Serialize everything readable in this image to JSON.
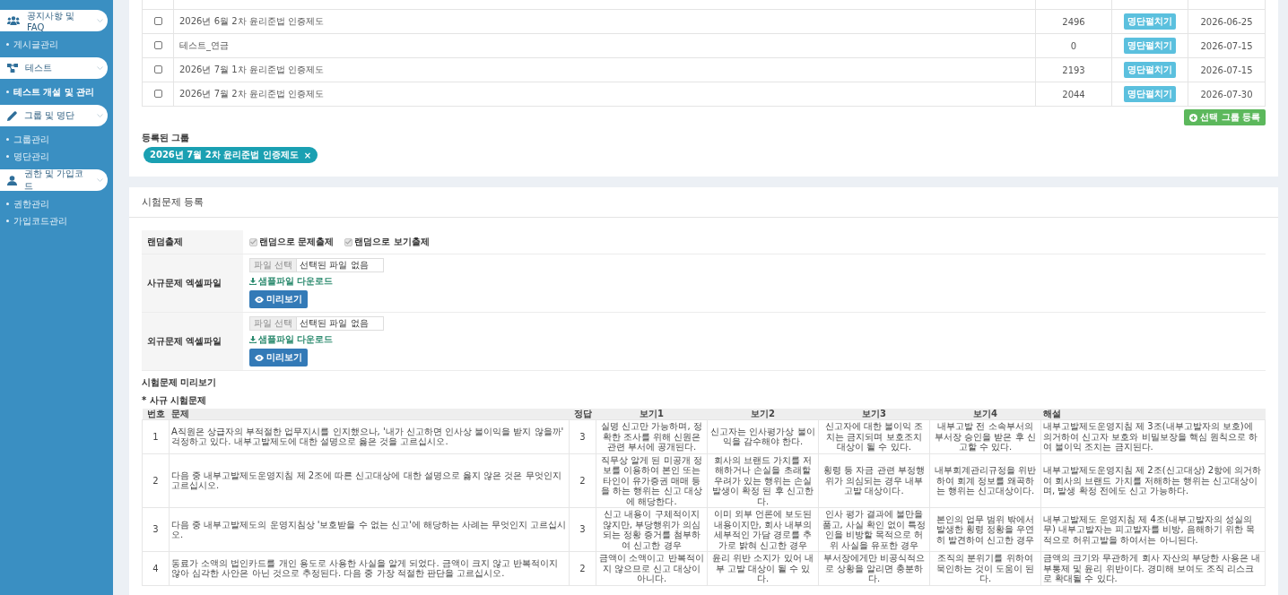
{
  "sidebar": {
    "groups": [
      {
        "label": "공지사항 및 FAQ",
        "items": [
          {
            "label": "게시글관리",
            "selected": false
          }
        ]
      },
      {
        "label": "테스트",
        "items": [
          {
            "label": "테스트 개설 및 관리",
            "selected": true
          }
        ]
      },
      {
        "label": "그룹 및 명단",
        "items": [
          {
            "label": "그룹관리",
            "selected": false
          },
          {
            "label": "명단관리",
            "selected": false
          }
        ]
      },
      {
        "label": "권한 및 가입코드",
        "items": [
          {
            "label": "권한관리",
            "selected": false
          },
          {
            "label": "가입코드관리",
            "selected": false
          }
        ]
      }
    ]
  },
  "group_table": {
    "rows": [
      {
        "checked": false,
        "name": "2026년 6월 2차 윤리준법 인증제도",
        "count": "2496",
        "button": "명단펼치기",
        "date": "2026-06-25"
      },
      {
        "checked": false,
        "name": "테스트_연금",
        "count": "0",
        "button": "명단펼치기",
        "date": "2026-07-15"
      },
      {
        "checked": false,
        "name": "2026년 7월 1차 윤리준법 인증제도",
        "count": "2193",
        "button": "명단펼치기",
        "date": "2026-07-15"
      },
      {
        "checked": false,
        "name": "2026년 7월 2차 윤리준법 인증제도",
        "count": "2044",
        "button": "명단펼치기",
        "date": "2026-07-30"
      }
    ],
    "register_button": "선택 그룹 등록",
    "registered_label": "등록된 그룹",
    "registered_tags": [
      {
        "label": "2026년 7월 2차 윤리준법 인증제도",
        "remove": "×"
      }
    ]
  },
  "exam_register": {
    "title": "시험문제 등록",
    "random": {
      "label": "랜덤출제",
      "options": [
        {
          "label": "랜덤으로 문제출제",
          "checked": true,
          "disabled": true
        },
        {
          "label": "랜덤으로 보기출제",
          "checked": true,
          "disabled": true
        }
      ]
    },
    "files": [
      {
        "label": "사규문제 엑셀파일",
        "choose_button": "파일 선택",
        "file_status": "선택된 파일 없음",
        "sample_link": "샘플파일 다운로드",
        "preview_button": "미리보기"
      },
      {
        "label": "외규문제 엑셀파일",
        "choose_button": "파일 선택",
        "file_status": "선택된 파일 없음",
        "sample_link": "샘플파일 다운로드",
        "preview_button": "미리보기"
      }
    ],
    "preview_title": "시험문제 미리보기",
    "section_title": "* 사규 시험문제",
    "preview_table": {
      "columns": [
        "번호",
        "문제",
        "정답",
        "보기1",
        "보기2",
        "보기3",
        "보기4",
        "해설"
      ],
      "rows": [
        {
          "no": "1",
          "question": "A직원은 상급자의 부적절한 업무지시를 인지했으나, '내가 신고하면 인사상 불이익을 받지 않을까' 걱정하고 있다. 내부고발제도에 대한 설명으로 옳은 것을 고르십시오.",
          "answer": "3",
          "options": [
            "실명 신고만 가능하며, 정확한 조사를 위해 신원은 관련 부서에 공개된다.",
            "신고자는 인사평가상 불이익을 감수해야 한다.",
            "신고자에 대한 불이익 조치는 금지되며 보호조치 대상이 될 수 있다.",
            "내부고발 전 소속부서의 부서장 승인을 받은 후 신고할 수 있다."
          ],
          "explanation": "내부고발제도운영지침 제 3조(내부고발자의 보호)에 의거하여 신고자 보호와 비밀보장을 핵심 원칙으로 하여 불이익 조치는 금지된다."
        },
        {
          "no": "2",
          "question": "다음 중 내부고발제도운영지침 제 2조에 따른 신고대상에 대한 설명으로 옳지 않은 것은 무엇인지 고르십시오.",
          "answer": "2",
          "options": [
            "직무상 알게 된 미공개 정보를 이용하여 본인 또는 타인이 유가증권 매매 등을 하는 행위는 신고 대상에 해당한다.",
            "회사의 브랜드 가치를 저해하거나 손실을 초래할 우려가 있는 행위는 손실 발생이 확정 된 후 신고한다.",
            "횡령 등 자금 관련 부정행위가 의심되는 경우 내부고발 대상이다.",
            "내부회계관리규정을 위반하여 회계 정보를 왜곡하는 행위는 신고대상이다."
          ],
          "explanation": "내부고발제도운영지침 제 2조(신고대상) 2항에 의거하여 회사의 브랜드 가치를 저해하는 행위는 신고대상이며, 발생 확정 전에도 신고 가능하다."
        },
        {
          "no": "3",
          "question": "다음 중 내부고발제도의 운영지침상 '보호받을 수 없는 신고'에 해당하는 사례는 무엇인지 고르십시오.",
          "answer": "3",
          "options": [
            "신고 내용이 구체적이지 않지만, 부당행위가 의심되는 정황 증거를 첨부하여 신고한 경우",
            "이미 외부 언론에 보도된 내용이지만, 회사 내부의 세부적인 가담 경로를 추가로 밝혀 신고한 경우",
            "인사 평가 결과에 불만을 품고, 사실 확인 없이 특정인을 비방할 목적으로 허위 사실을 유포한 경우",
            "본인의 업무 범위 밖에서 발생한 횡령 정황을 우연히 발견하여 신고한 경우"
          ],
          "explanation": "내부고발제도 운영지침 제 4조(내부고발자의 성실의무) 내부고발자는 피고발자를 비방, 음해하기 위한 목적으로 허위고발을 하여서는 아니된다."
        },
        {
          "no": "4",
          "question": "동료가 소액의 법인카드를 개인 용도로 사용한 사실을 알게 되었다. 금액이 크지 않고 반복적이지 않아 심각한 사안은 아닌 것으로 추정된다. 다음 중 가장 적절한 판단을 고르십시오.",
          "answer": "2",
          "options": [
            "금액이 소액이고 반복적이지 않으므로 신고 대상이 아니다.",
            "윤리 위반 소지가 있어 내부 고발 대상이 될 수 있다.",
            "부서장에게만 비공식적으로 상황을 알리면 충분하다.",
            "조직의 분위기를 위하여 묵인하는 것이 도움이 된다."
          ],
          "explanation": "금액의 크기와 무관하게 회사 자산의 부당한 사용은 내부통제 및 윤리 위반이다. 경미해 보여도 조직 리스크로 확대될 수 있다."
        }
      ]
    }
  }
}
